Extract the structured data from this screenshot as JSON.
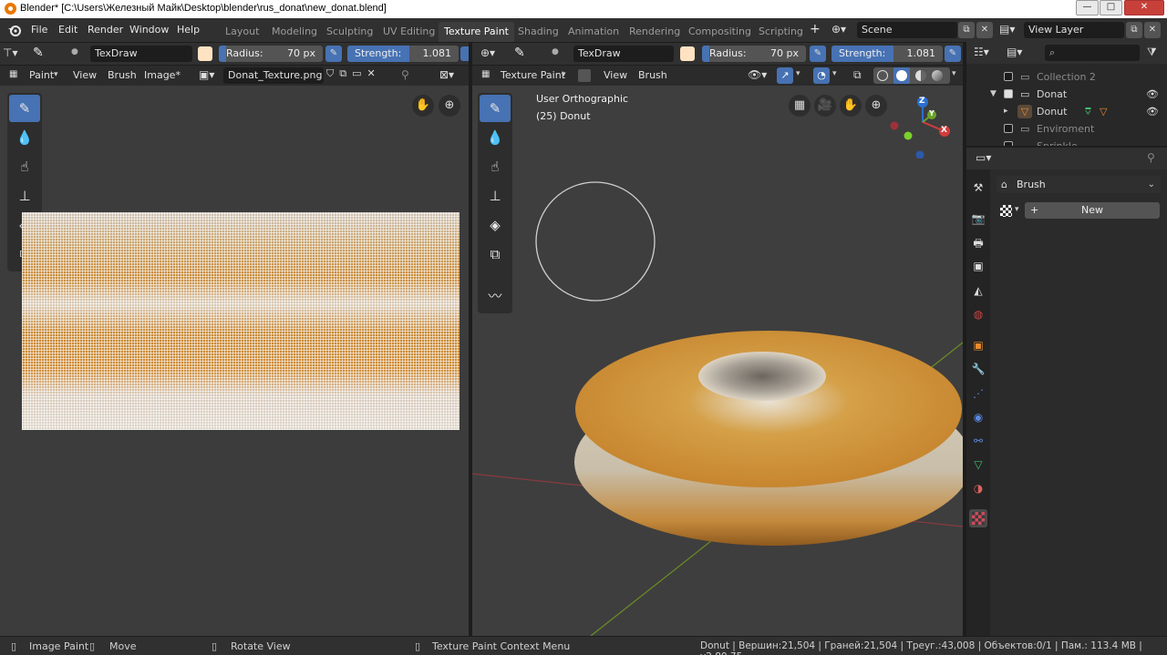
{
  "window": {
    "title": "Blender* [C:\\Users\\Железный Майк\\Desktop\\blender\\rus_donat\\new_donat.blend]",
    "min": "—",
    "max": "□",
    "close": "✕"
  },
  "menu": [
    "File",
    "Edit",
    "Render",
    "Window",
    "Help"
  ],
  "workspaces": [
    "Layout",
    "Modeling",
    "Sculpting",
    "UV Editing",
    "Texture Paint",
    "Shading",
    "Animation",
    "Rendering",
    "Compositing",
    "Scripting"
  ],
  "workspace_add": "+",
  "scene": {
    "name": "Scene",
    "view_layer": "View Layer"
  },
  "image_editor": {
    "brush_name": "TexDraw",
    "radius_label": "Radius:",
    "radius_value": "70 px",
    "strength_label": "Strength:",
    "strength_value": "1.081",
    "mode": "Paint",
    "menus": [
      "View",
      "Brush",
      "Image*"
    ],
    "image_name": "Donat_Texture.png",
    "brush_color": "#ffe2c2"
  },
  "viewport": {
    "brush_name": "TexDraw",
    "radius_label": "Radius:",
    "radius_value": "70 px",
    "strength_label": "Strength:",
    "strength_value": "1.081",
    "mode": "Texture Paint",
    "menus": [
      "View",
      "Brush"
    ],
    "overlay_title": "User Orthographic",
    "overlay_object": "(25) Donut",
    "gizmo": {
      "x": "X",
      "y": "Y",
      "z": "Z"
    }
  },
  "outliner": {
    "search_placeholder": "",
    "items": [
      {
        "label": "Collection 2"
      },
      {
        "label": "Donat"
      },
      {
        "label": "Donut"
      },
      {
        "label": "Enviroment"
      },
      {
        "label": "Sprinkle"
      }
    ]
  },
  "properties": {
    "brush_label": "Brush",
    "new_label": "New",
    "new_plus": "+"
  },
  "statusbar": {
    "image_paint": "Image Paint",
    "move": "Move",
    "rotate_view": "Rotate View",
    "context_menu": "Texture Paint Context Menu",
    "stats": "Donut | Вершин:21,504 | Граней:21,504 | Треуг.:43,008 | Объектов:0/1 | Пам.: 113.4 MB | v2.80.75"
  },
  "colors": {
    "accent": "#4772b3",
    "blender_orange": "#ea7600",
    "background": "#3d3d3d"
  }
}
